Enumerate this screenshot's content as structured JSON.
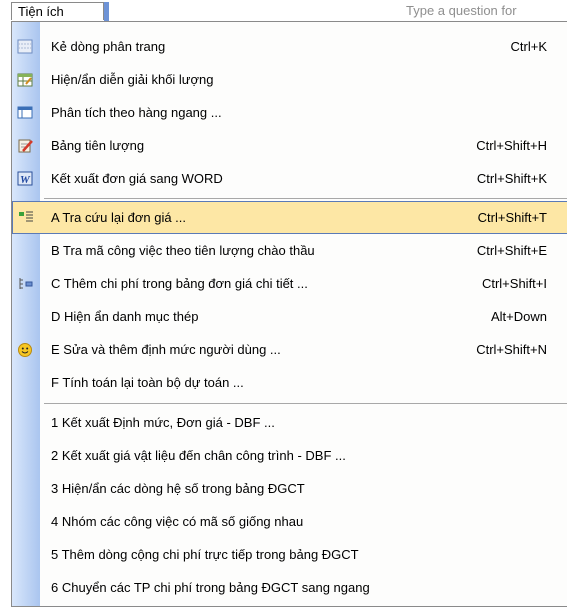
{
  "menubar": {
    "menu_title": "Tiện ích",
    "question_placeholder": "Type a question for"
  },
  "menu": {
    "items": [
      {
        "label": "Kẻ dòng phân trang",
        "shortcut": "Ctrl+K",
        "icon": "page-lines-icon"
      },
      {
        "label": "Hiện/ẩn diễn giải khối lượng",
        "shortcut": "",
        "icon": "table-explain-icon"
      },
      {
        "label": "Phân tích theo hàng ngang ...",
        "shortcut": "",
        "icon": "horizontal-table-icon"
      },
      {
        "label": "Bảng tiên lượng",
        "shortcut": "Ctrl+Shift+H",
        "icon": "notepad-pencil-icon"
      },
      {
        "label": "Kết xuất đơn giá sang WORD",
        "shortcut": "Ctrl+Shift+K",
        "icon": "word-icon"
      },
      {
        "label": "A Tra cứu lại đơn giá ...",
        "shortcut": "Ctrl+Shift+T",
        "icon": "lookup-list-icon"
      },
      {
        "label": "B Tra mã công việc theo tiên lượng chào thầu",
        "shortcut": "Ctrl+Shift+E",
        "icon": ""
      },
      {
        "label": "C Thêm chi phí trong bảng đơn giá chi tiết ...",
        "shortcut": "Ctrl+Shift+I",
        "icon": "add-cost-icon"
      },
      {
        "label": "D Hiện ẩn danh mục thép",
        "shortcut": "Alt+Down",
        "icon": ""
      },
      {
        "label": "E Sửa và thêm định mức người dùng ...",
        "shortcut": "Ctrl+Shift+N",
        "icon": "smiley-icon"
      },
      {
        "label": "F Tính toán lại toàn bộ dự toán ...",
        "shortcut": "",
        "icon": ""
      },
      {
        "label": "1 Kết xuất Định mức, Đơn giá - DBF ...",
        "shortcut": "",
        "icon": ""
      },
      {
        "label": "2 Kết xuất giá vật liệu đến chân công trình - DBF ...",
        "shortcut": "",
        "icon": ""
      },
      {
        "label": "3 Hiện/ẩn các dòng hệ số trong bảng ĐGCT",
        "shortcut": "",
        "icon": ""
      },
      {
        "label": "4 Nhóm các công việc có mã số giống nhau",
        "shortcut": "",
        "icon": ""
      },
      {
        "label": "5 Thêm dòng cộng chi phí trực tiếp trong bảng ĐGCT",
        "shortcut": "",
        "icon": ""
      },
      {
        "label": "6 Chuyển các TP chi phí trong bảng ĐGCT sang ngang",
        "shortcut": "",
        "icon": ""
      }
    ],
    "highlighted_index": 5,
    "highlight_color": "#fde7a5",
    "highlight_border": "#5b7ab6"
  }
}
